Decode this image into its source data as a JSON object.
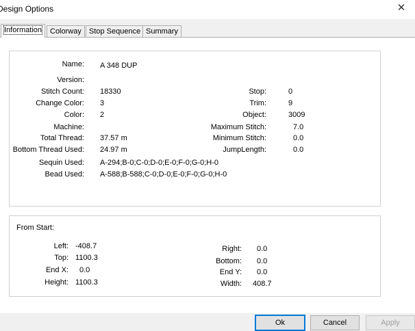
{
  "window": {
    "title": "Design Options",
    "close_glyph": "✕"
  },
  "tabs": [
    "Information",
    "Colorway",
    "Stop Sequence",
    "Summary"
  ],
  "info": {
    "name": {
      "label": "Name:",
      "value": "A 348 DUP"
    },
    "version": {
      "label": "Version:",
      "value": ""
    },
    "stitch_count": {
      "label": "Stitch Count:",
      "value": "18330"
    },
    "change_color": {
      "label": "Change Color:",
      "value": "3"
    },
    "color": {
      "label": "Color:",
      "value": "2"
    },
    "machine": {
      "label": "Machine:",
      "value": ""
    },
    "total_thread": {
      "label": "Total Thread:",
      "value": "37.57 m"
    },
    "bottom_thread": {
      "label": "Bottom Thread Used:",
      "value": "24.97 m"
    },
    "sequin_used": {
      "label": "Sequin Used:",
      "value": "A-294;B-0;C-0;D-0;E-0;F-0;G-0;H-0"
    },
    "bead_used": {
      "label": "Bead Used:",
      "value": "A-588;B-588;C-0;D-0;E-0;F-0;G-0;H-0"
    },
    "stop": {
      "label": "Stop:",
      "value": "0"
    },
    "trim": {
      "label": "Trim:",
      "value": "9"
    },
    "object": {
      "label": "Object:",
      "value": "3009"
    },
    "max_stitch": {
      "label": "Maximum Stitch:",
      "value": "7.0"
    },
    "min_stitch": {
      "label": "Minimum Stitch:",
      "value": "0.0"
    },
    "jump_length": {
      "label": "JumpLength:",
      "value": "0.0"
    }
  },
  "from_start": {
    "title": "From Start:",
    "left": {
      "label": "Left:",
      "value": "-408.7"
    },
    "top": {
      "label": "Top:",
      "value": "1100.3"
    },
    "end_x": {
      "label": "End X:",
      "value": "0.0"
    },
    "height": {
      "label": "Height:",
      "value": "1100.3"
    },
    "right": {
      "label": "Right:",
      "value": "0.0"
    },
    "bottom": {
      "label": "Bottom:",
      "value": "0.0"
    },
    "end_y": {
      "label": "End Y:",
      "value": "0.0"
    },
    "width": {
      "label": "Width:",
      "value": "408.7"
    }
  },
  "buttons": {
    "ok": "Ok",
    "cancel": "Cancel",
    "apply": "Apply"
  }
}
